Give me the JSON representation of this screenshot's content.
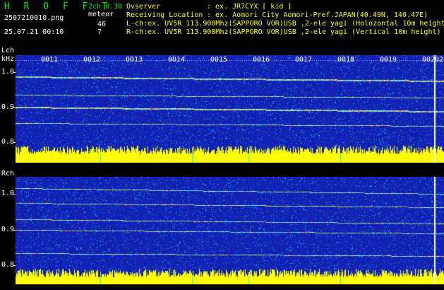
{
  "header": {
    "app_title": "H R O F F T",
    "version": "2ch 0.30",
    "filename": "2507210010.png",
    "timestamp": "25.07.21 00:10",
    "meteor_label": "meteor",
    "meteor_l": "46",
    "meteor_r": "7",
    "observer_label": "Ovserver",
    "observer_value": ": ex. JR7CYX [ kid ]",
    "location_label": "Receiving Location",
    "location_value": ": ex. Aomori City Aomori-Pref.JAPAN(40.49N, 140.47E)",
    "lch_info": "L-ch:ex. UV5R 113.900Mhz(SAPPORO VOR)USB ,2-ele yagi (Holozontal 10m height)",
    "rch_info": "R-ch:ex. UV5R 113.900Mhz(SAPPORO VOR)USB ,2-ele yagi (Vertical 10m height)"
  },
  "lch": {
    "label": "Lch",
    "unit": "kHz",
    "ticks": [
      "1.0",
      "0.9",
      "0.8"
    ]
  },
  "rch": {
    "label": "Rch",
    "ticks": [
      "1.0",
      "0.9",
      "0.8"
    ]
  },
  "minute_marks": [
    "0011",
    "0012",
    "0013",
    "0014",
    "0015",
    "0016",
    "0017",
    "0018",
    "0019",
    "0020",
    "2"
  ],
  "colors": {
    "background": "#000000",
    "header_green": "#00e600",
    "header_yellow": "#ffff00",
    "spectrum_blue": "#1a2fd0",
    "signal_yellow": "#ffff00"
  }
}
